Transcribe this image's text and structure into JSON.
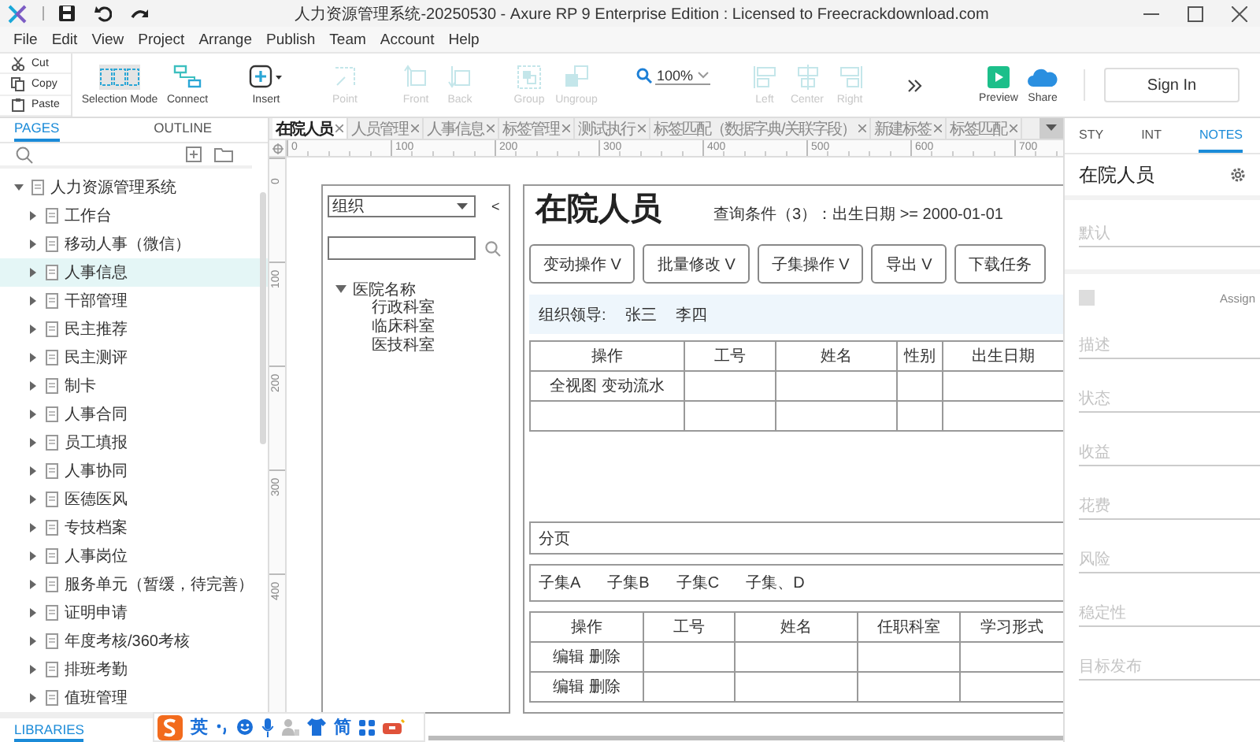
{
  "window": {
    "title": "人力资源管理系统-20250530  - Axure RP 9 Enterprise Edition : Licensed to Freecrackdownload.com"
  },
  "menu": [
    "File",
    "Edit",
    "View",
    "Project",
    "Arrange",
    "Publish",
    "Team",
    "Account",
    "Help"
  ],
  "clipboard": [
    {
      "kind": "cut",
      "label": "Cut"
    },
    {
      "kind": "copy",
      "label": "Copy"
    },
    {
      "kind": "paste",
      "label": "Paste"
    }
  ],
  "tool_groups": [
    [
      {
        "kind": "selection",
        "label": "Selection Mode",
        "selected": true,
        "disabled": false
      },
      {
        "kind": "connect",
        "label": "Connect",
        "selected": false,
        "disabled": false
      }
    ],
    [
      {
        "kind": "insert",
        "label": "Insert",
        "selected": false,
        "disabled": false
      }
    ],
    [
      {
        "kind": "point",
        "label": "Point",
        "selected": false,
        "disabled": true
      }
    ],
    [
      {
        "kind": "front",
        "label": "Front",
        "selected": false,
        "disabled": true
      },
      {
        "kind": "back",
        "label": "Back",
        "selected": false,
        "disabled": true
      }
    ],
    [
      {
        "kind": "group",
        "label": "Group",
        "selected": false,
        "disabled": true
      },
      {
        "kind": "ungroup",
        "label": "Ungroup",
        "selected": false,
        "disabled": true
      }
    ],
    [
      {
        "kind": "zoom",
        "value": "100%",
        "selected": false,
        "disabled": false
      }
    ],
    [
      {
        "kind": "left",
        "label": "Left",
        "selected": false,
        "disabled": true
      },
      {
        "kind": "center",
        "label": "Center",
        "selected": false,
        "disabled": true
      },
      {
        "kind": "right",
        "label": "Right",
        "selected": false,
        "disabled": true
      }
    ],
    [
      {
        "kind": "more",
        "selected": false,
        "disabled": false
      }
    ],
    [
      {
        "kind": "preview",
        "label": "Preview",
        "selected": false,
        "disabled": false
      },
      {
        "kind": "share",
        "label": "Share",
        "selected": false,
        "disabled": false
      }
    ]
  ],
  "sign_in": {
    "label": "Sign In"
  },
  "pages_panel": {
    "tabs": [
      {
        "label": "PAGES",
        "selected": true
      },
      {
        "label": "OUTLINE",
        "selected": false
      }
    ],
    "tree": [
      {
        "label": "人力资源管理系统",
        "expanded": true,
        "selected": false,
        "children": [
          {
            "label": "工作台",
            "expanded": false,
            "selected": false
          },
          {
            "label": "移动人事（微信）",
            "expanded": false,
            "selected": false
          },
          {
            "label": "人事信息",
            "expanded": false,
            "selected": true
          },
          {
            "label": "干部管理",
            "expanded": false,
            "selected": false
          },
          {
            "label": "民主推荐",
            "expanded": false,
            "selected": false
          },
          {
            "label": "民主测评",
            "expanded": false,
            "selected": false
          },
          {
            "label": "制卡",
            "expanded": false,
            "selected": false
          },
          {
            "label": "人事合同",
            "expanded": false,
            "selected": false
          },
          {
            "label": "员工填报",
            "expanded": false,
            "selected": false
          },
          {
            "label": "人事协同",
            "expanded": false,
            "selected": false
          },
          {
            "label": "医德医风",
            "expanded": false,
            "selected": false
          },
          {
            "label": "专技档案",
            "expanded": false,
            "selected": false
          },
          {
            "label": "人事岗位",
            "expanded": false,
            "selected": false
          },
          {
            "label": "服务单元（暂缓，待完善）",
            "expanded": false,
            "selected": false
          },
          {
            "label": "证明申请",
            "expanded": false,
            "selected": false
          },
          {
            "label": "年度考核/360考核",
            "expanded": false,
            "selected": false
          },
          {
            "label": "排班考勤",
            "expanded": false,
            "selected": false
          },
          {
            "label": "值班管理",
            "expanded": false,
            "selected": false
          }
        ]
      }
    ],
    "footer_tab": {
      "label": "LIBRARIES",
      "selected": true
    }
  },
  "ime_bar": {
    "language": "英",
    "script": "简"
  },
  "document_tabs": [
    {
      "label": "在院人员",
      "selected": true
    },
    {
      "label": "人员管理",
      "selected": false
    },
    {
      "label": "人事信息",
      "selected": false
    },
    {
      "label": "标签管理",
      "selected": false
    },
    {
      "label": "测试执行",
      "selected": false
    },
    {
      "label": "标签匹配（数据字典/关联字段）",
      "selected": false
    },
    {
      "label": "新建标签",
      "selected": false
    },
    {
      "label": "标签匹配",
      "selected": false
    }
  ],
  "ruler": {
    "horizontal": [
      "0",
      "100",
      "200",
      "300",
      "400",
      "500",
      "600",
      "700"
    ],
    "vertical": [
      "0",
      "100",
      "200",
      "300",
      "400"
    ]
  },
  "canvas": {
    "org_panel": {
      "select": {
        "value": "组织"
      },
      "collapse": "<",
      "tree": {
        "label": "医院名称",
        "expanded": true,
        "children": [
          {
            "label": "行政科室"
          },
          {
            "label": "临床科室"
          },
          {
            "label": "医技科室"
          }
        ]
      }
    },
    "content": {
      "title": "在院人员",
      "query": "查询条件（3）：出生日期 >= 2000-01-01",
      "buttons": [
        "变动操作 V",
        "批量修改 V",
        "子集操作 V",
        "导出 V",
        "下载任务"
      ],
      "leaders": {
        "label": "组织领导:",
        "names": [
          "张三",
          "李四"
        ]
      },
      "table": {
        "columns": [
          "操作",
          "工号",
          "姓名",
          "性别",
          "出生日期"
        ],
        "rows": [
          [
            "全视图 变动流水",
            null,
            null,
            null,
            null
          ],
          [
            null,
            null,
            null,
            null,
            null
          ]
        ]
      },
      "pagination": "分页",
      "subsets": [
        "子集A",
        "子集B",
        "子集C",
        "子集、D"
      ],
      "subset_table": {
        "columns": [
          "操作",
          "工号",
          "姓名",
          "任职科室",
          "学习形式"
        ],
        "rows": [
          [
            "编辑 删除",
            null,
            null,
            null,
            null
          ],
          [
            "编辑 删除",
            null,
            null,
            null,
            null
          ]
        ]
      }
    }
  },
  "notes_panel": {
    "tabs": [
      {
        "label": "STY",
        "selected": false
      },
      {
        "label": "INT",
        "selected": false
      },
      {
        "label": "NOTES",
        "selected": true
      }
    ],
    "page_title": "在院人员",
    "default_field": {
      "placeholder": "默认"
    },
    "assign": {
      "checked": false,
      "label": "Assign"
    },
    "fields": [
      {
        "placeholder": "描述"
      },
      {
        "placeholder": "状态"
      },
      {
        "placeholder": "收益"
      },
      {
        "placeholder": "花费"
      },
      {
        "placeholder": "风险"
      },
      {
        "placeholder": "稳定性"
      },
      {
        "placeholder": "目标发布"
      }
    ]
  }
}
